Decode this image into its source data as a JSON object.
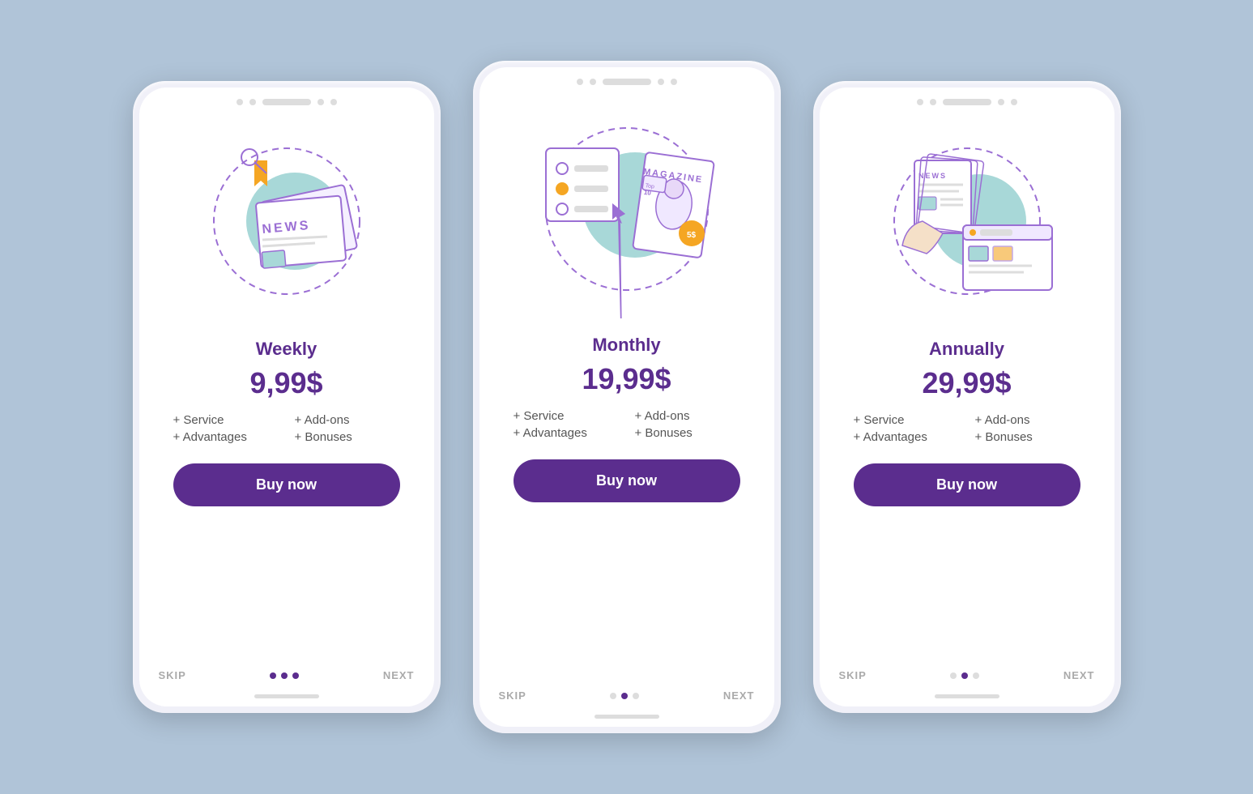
{
  "background_color": "#b0c4d8",
  "phones": [
    {
      "id": "weekly",
      "plan_title": "Weekly",
      "plan_price": "9,99$",
      "features": [
        "+ Service",
        "+ Add-ons",
        "+ Advantages",
        "+ Bonuses"
      ],
      "button_label": "Buy now",
      "skip_label": "SKIP",
      "next_label": "NEXT",
      "illustration": "weekly-news"
    },
    {
      "id": "monthly",
      "plan_title": "Monthly",
      "plan_price": "19,99$",
      "features": [
        "+ Service",
        "+ Add-ons",
        "+ Advantages",
        "+ Bonuses"
      ],
      "button_label": "Buy now",
      "skip_label": "SKIP",
      "next_label": "NEXT",
      "illustration": "monthly-magazine"
    },
    {
      "id": "annually",
      "plan_title": "Annually",
      "plan_price": "29,99$",
      "features": [
        "+ Service",
        "+ Add-ons",
        "+ Advantages",
        "+ Bonuses"
      ],
      "button_label": "Buy now",
      "skip_label": "SKIP",
      "next_label": "NEXT",
      "illustration": "annually-news"
    }
  ],
  "colors": {
    "purple": "#5b2d8e",
    "light_purple": "#9b6fd4",
    "teal": "#a8d8d8",
    "orange": "#f5a623",
    "bg": "#b0c4d8"
  }
}
